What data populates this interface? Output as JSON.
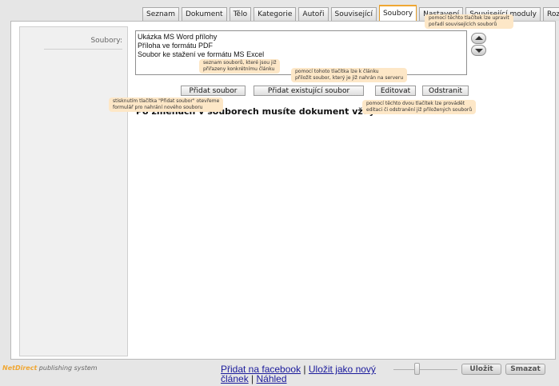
{
  "tabs": [
    {
      "label": "Seznam",
      "active": false
    },
    {
      "label": "Dokument",
      "active": false
    },
    {
      "label": "Tělo",
      "active": false
    },
    {
      "label": "Kategorie",
      "active": false
    },
    {
      "label": "Autoři",
      "active": false
    },
    {
      "label": "Související",
      "active": false
    },
    {
      "label": "Soubory",
      "active": true
    },
    {
      "label": "Nastavení",
      "active": false
    },
    {
      "label": "Související moduly",
      "active": false
    },
    {
      "label": "Rozšířené",
      "active": false
    }
  ],
  "files": {
    "label": "Soubory:",
    "items": [
      "Ukázka MS Word přílohy",
      "Příloha ve formátu PDF",
      "Soubor ke stažení ve formátu MS Excel"
    ]
  },
  "buttons": {
    "add_file": "Přidat soubor",
    "add_existing": "Přidat existující soubor",
    "edit": "Editovat",
    "remove": "Odstranit"
  },
  "warning": "Po změnách v souborech musíte dokument vždy uložit",
  "tips": {
    "order": [
      "pomocí těchto tlačítek lze upravit",
      "pořadí souvisejících souborů"
    ],
    "list": [
      "seznam souborů, které jsou již",
      "přiřazeny konkrétnímu článku"
    ],
    "existing": [
      "pomocí tohoto tlačítka lze k článku",
      "přiložit soubor, který je již nahrán na serveru"
    ],
    "add": [
      "stisknutím tlačítka \"Přidat soubor\" otevřeme",
      "formulář pro nahrání nového souboru"
    ],
    "edit_remove": [
      "pomocí těchto dvou tlačítek lze provádět",
      "editaci či odstranění již přiložených souborů"
    ]
  },
  "footer": {
    "brand_1": "NetDirect",
    "brand_2": " publishing system",
    "link_facebook": "Přidat na facebook",
    "sep1": " | ",
    "link_save_new": "Uložit jako nový článek",
    "sep2": " | ",
    "link_preview": "Náhled",
    "save": "Uložit",
    "delete": "Smazat"
  },
  "icons": {
    "order_up": "arrow-up-icon",
    "order_down": "arrow-down-icon"
  },
  "colors": {
    "accent": "#f0a733",
    "tip_bg": "#fde7c7",
    "link": "#1a1a9c"
  }
}
